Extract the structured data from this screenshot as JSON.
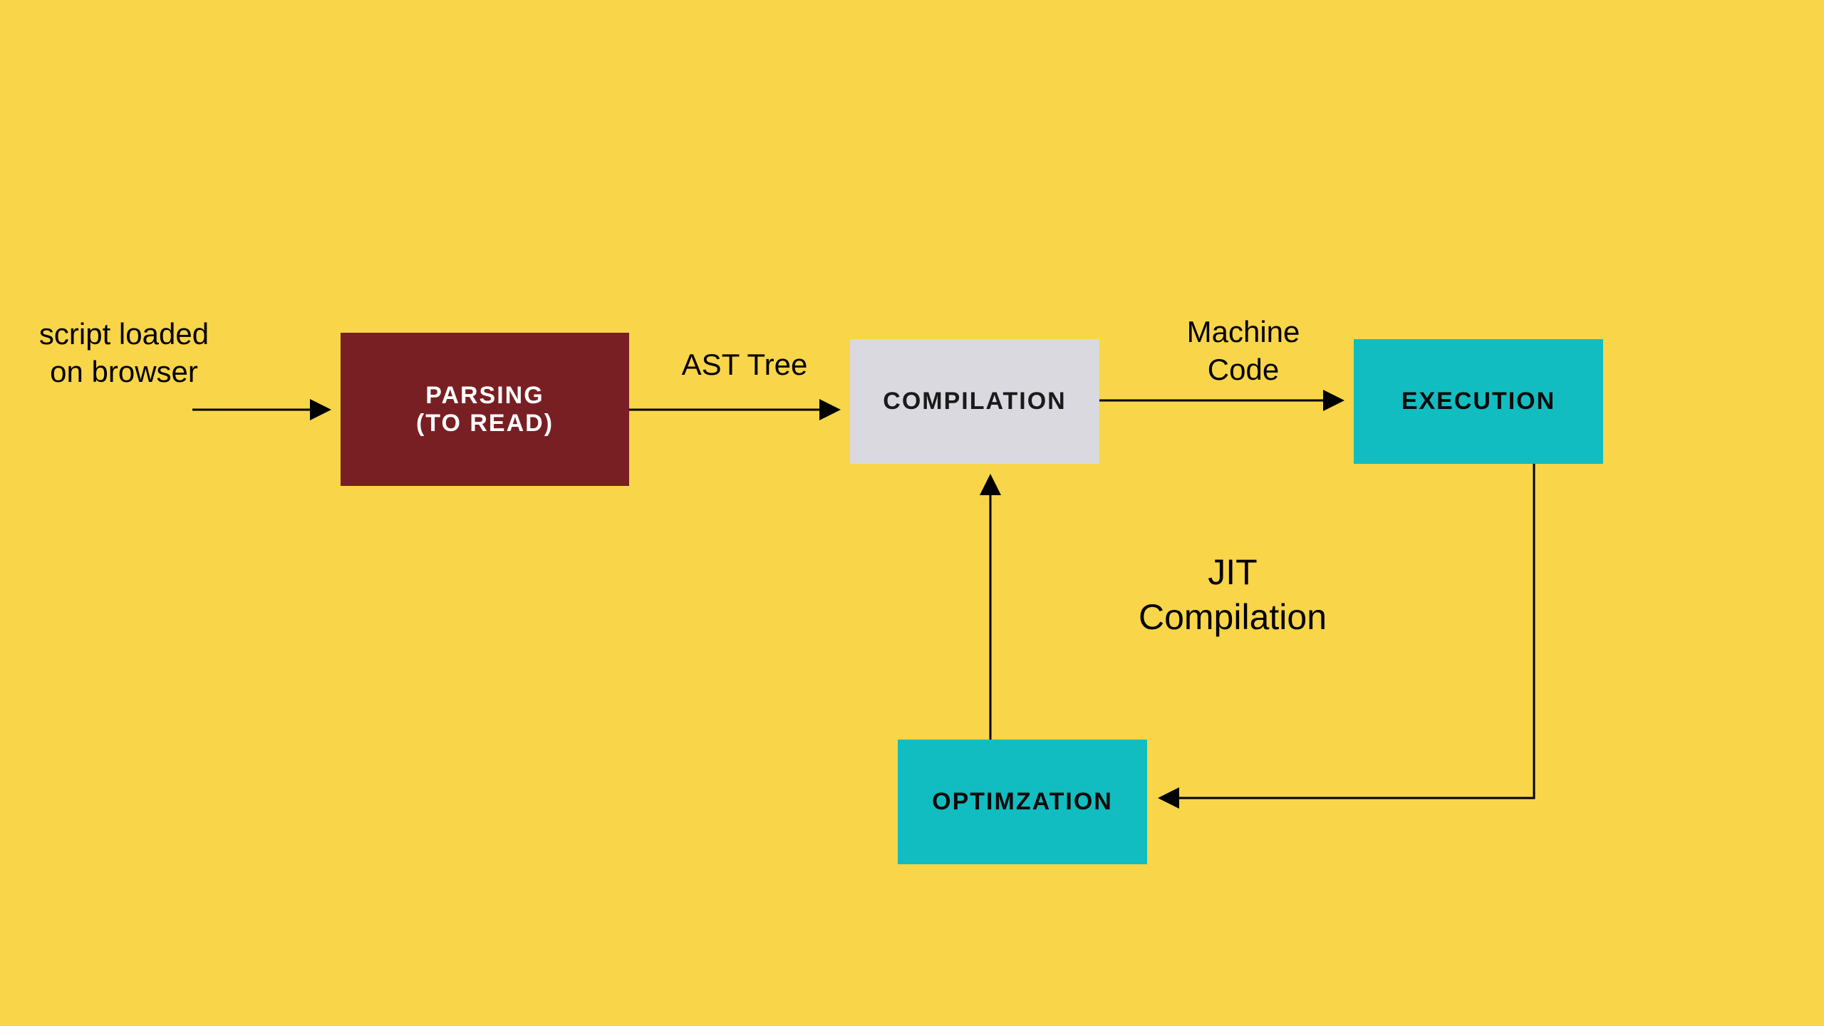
{
  "labels": {
    "script": "script loaded\non browser",
    "ast": "AST Tree",
    "machine": "Machine\nCode",
    "jit": "JIT\nCompilation"
  },
  "nodes": {
    "parsing_line1": "PARSING",
    "parsing_line2": "(TO READ)",
    "compilation": "COMPILATION",
    "execution": "EXECUTION",
    "optimization": "OPTIMZATION"
  },
  "colors": {
    "background": "#f9d54a",
    "parsing": "#781f23",
    "compilation": "#d9d9df",
    "execution": "#11bdc1",
    "optimization": "#11bdc1",
    "arrow": "#000000"
  }
}
